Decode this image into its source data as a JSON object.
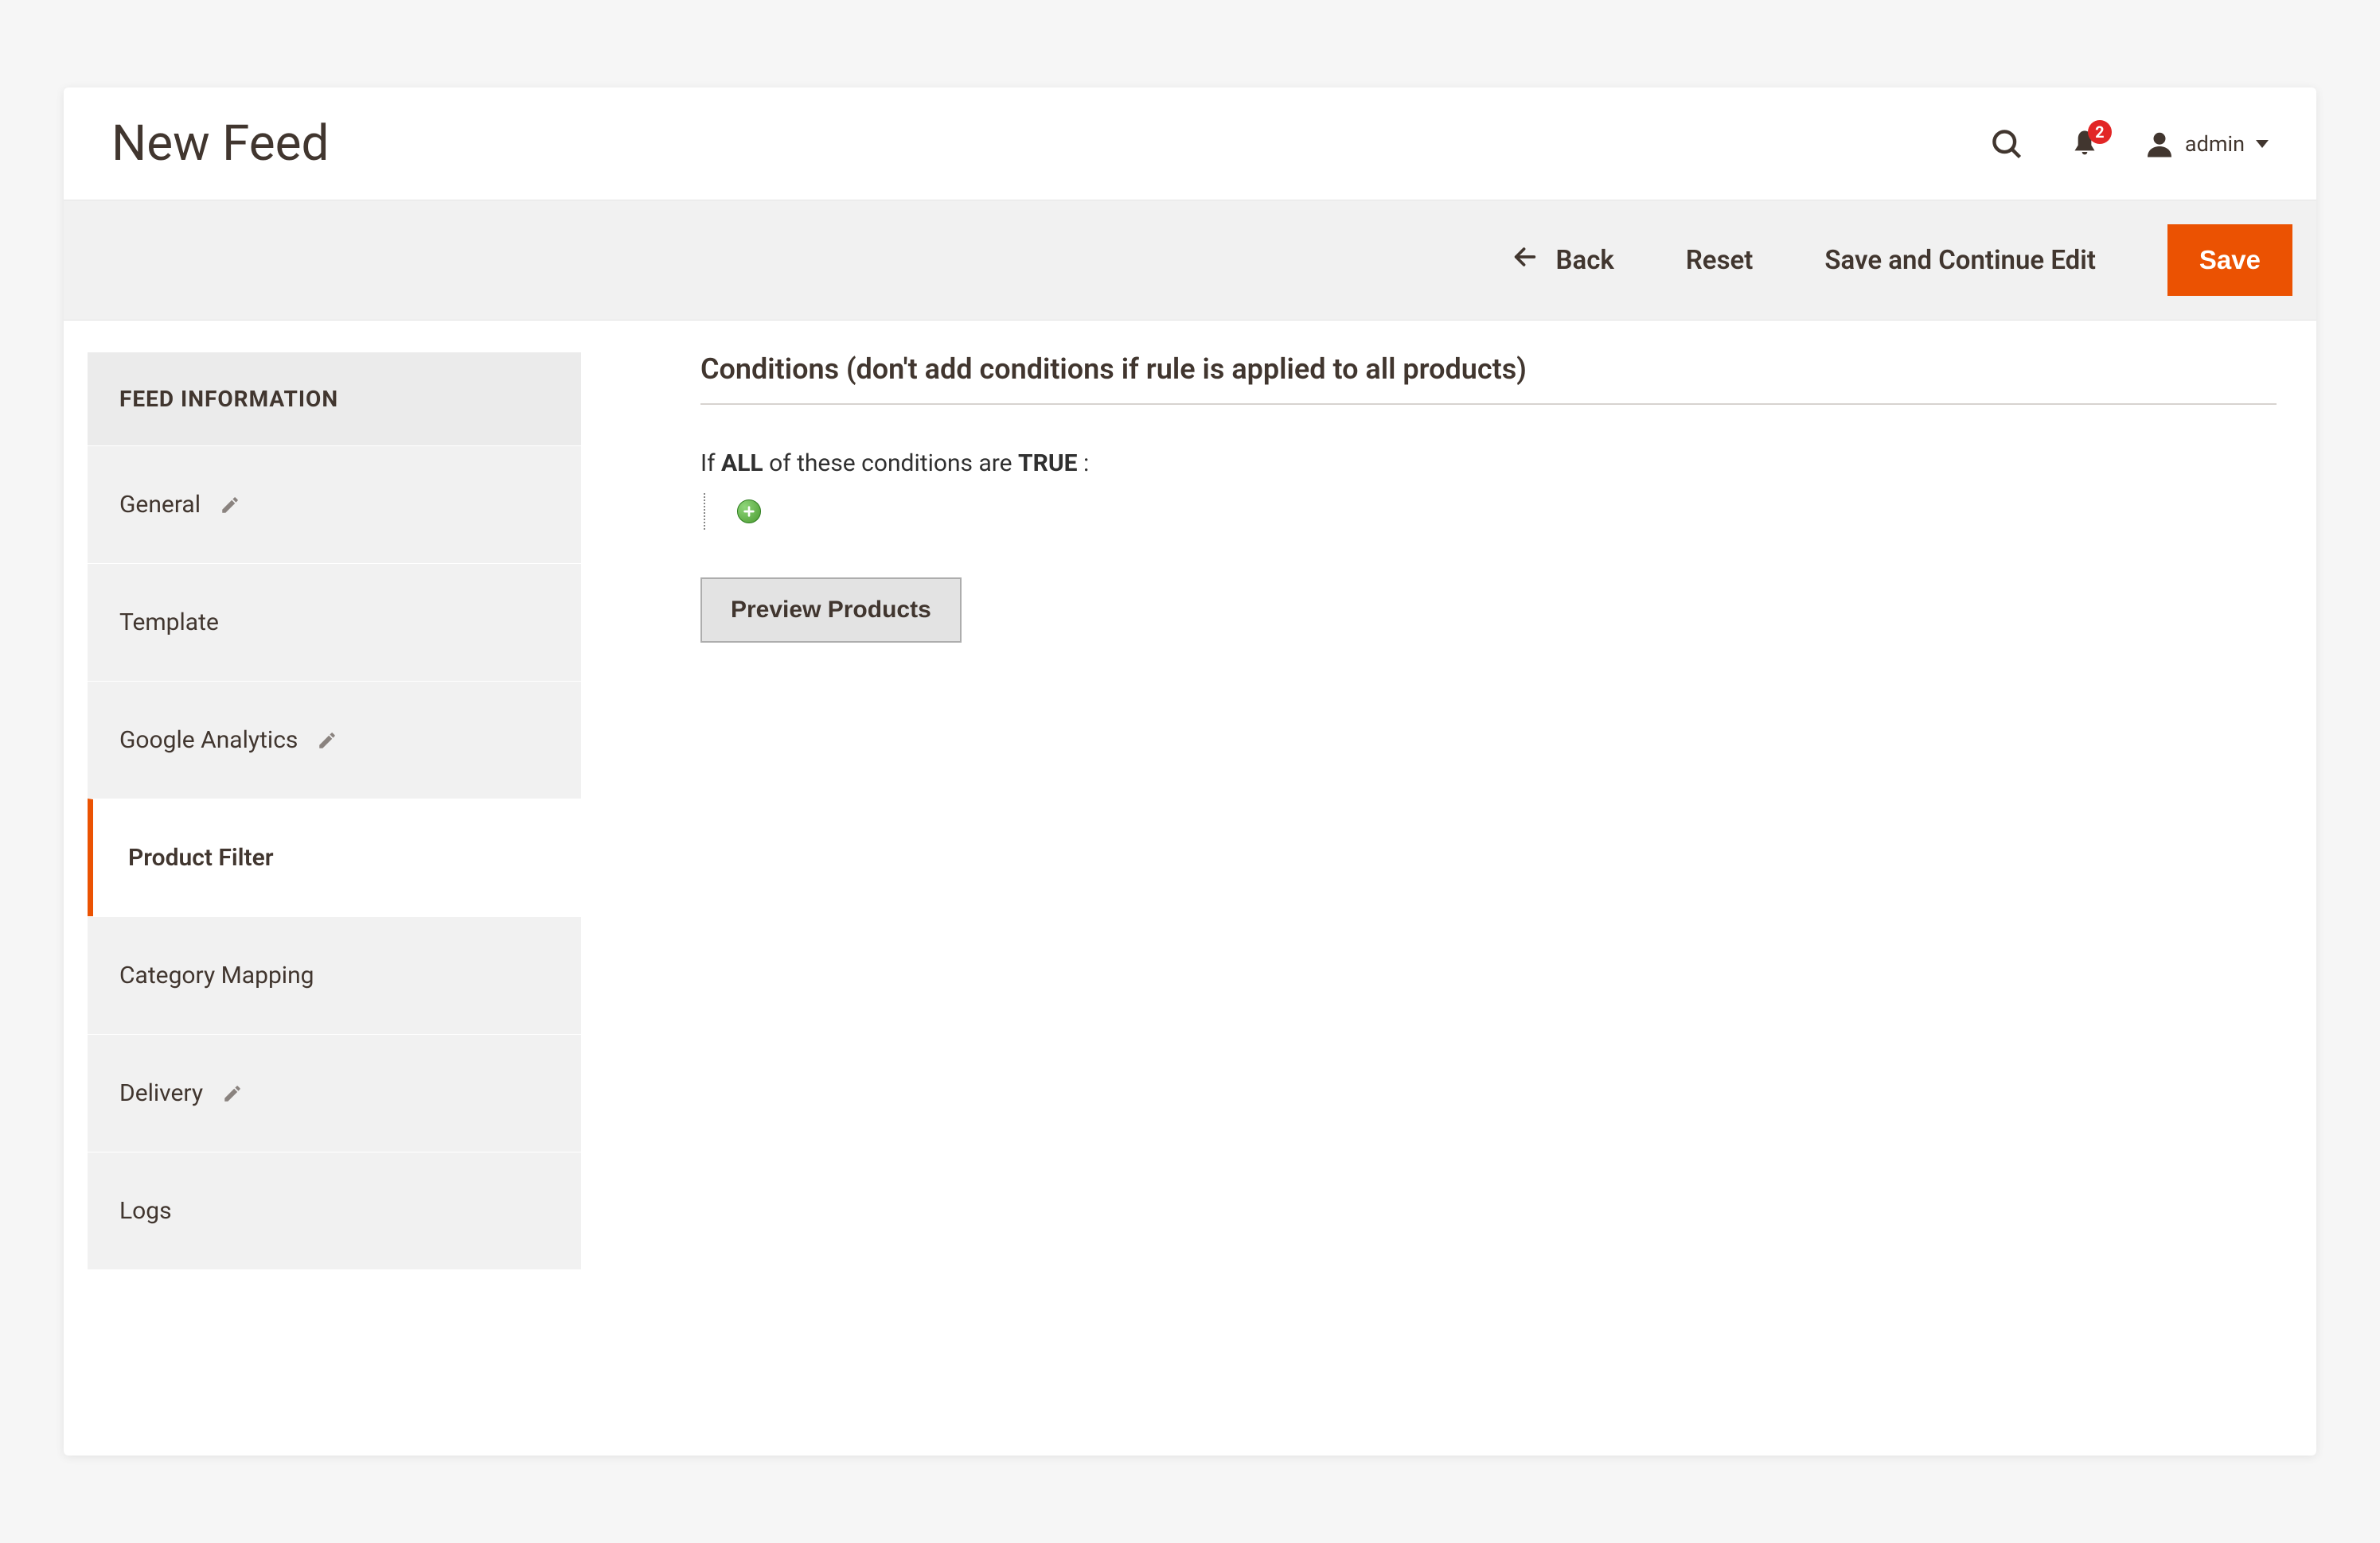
{
  "header": {
    "title": "New Feed",
    "notification_count": "2",
    "user_label": "admin"
  },
  "actions": {
    "back": "Back",
    "reset": "Reset",
    "save_continue": "Save and Continue Edit",
    "save": "Save"
  },
  "sidebar": {
    "header": "FEED INFORMATION",
    "items": [
      {
        "label": "General",
        "editable": true,
        "active": false
      },
      {
        "label": "Template",
        "editable": false,
        "active": false
      },
      {
        "label": "Google Analytics",
        "editable": true,
        "active": false
      },
      {
        "label": "Product Filter",
        "editable": false,
        "active": true
      },
      {
        "label": "Category Mapping",
        "editable": false,
        "active": false
      },
      {
        "label": "Delivery",
        "editable": true,
        "active": false
      },
      {
        "label": "Logs",
        "editable": false,
        "active": false
      }
    ]
  },
  "main": {
    "section_title": "Conditions (don't add conditions if rule is applied to all products)",
    "condition_prefix": "If ",
    "condition_all": "ALL",
    "condition_mid": "  of these conditions are ",
    "condition_true": "TRUE",
    "condition_suffix": " :",
    "preview_button": "Preview Products"
  }
}
